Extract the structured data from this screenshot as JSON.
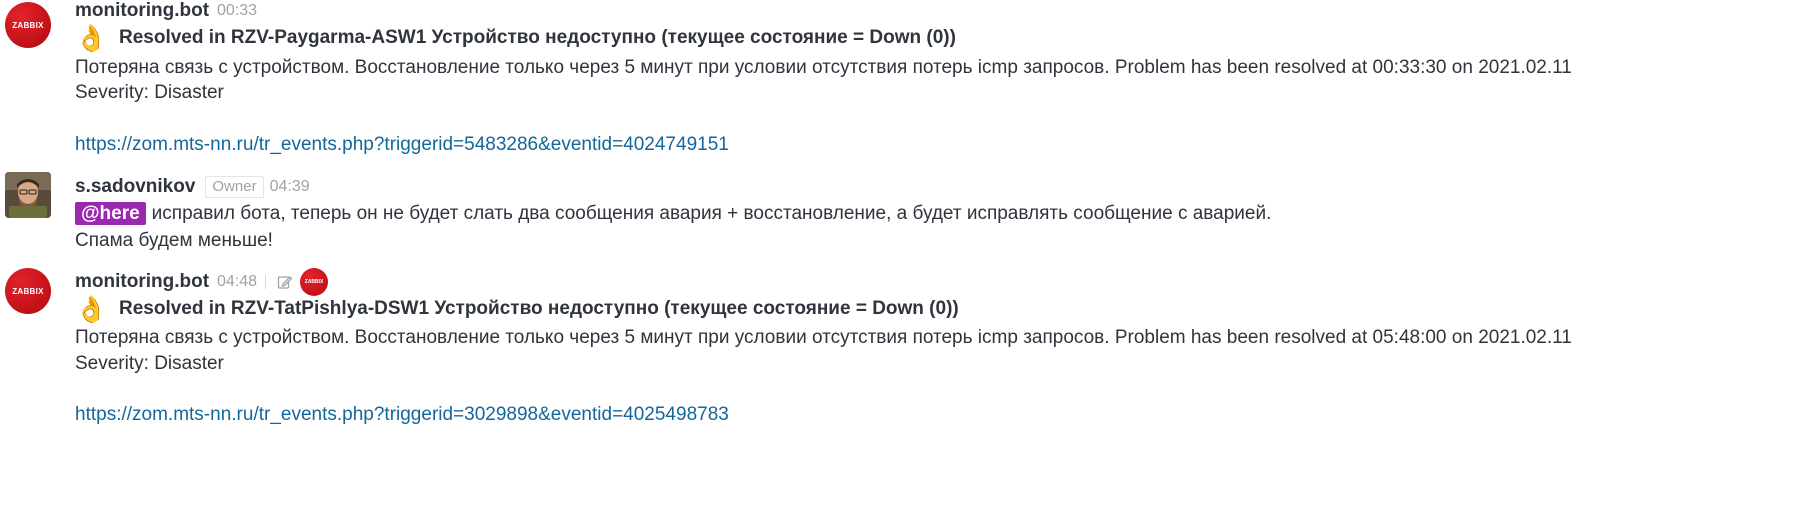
{
  "messages": [
    {
      "username": "monitoring.bot",
      "time": "00:33",
      "avatar_text": "ZABBIX",
      "title_emoji": "👌",
      "title": "Resolved in RZV-Paygarma-ASW1 Устройство недоступно (текущее состояние = Down (0))",
      "body": "Потеряна связь с устройством. Восстановление только через 5 минут при условии отсутствия потерь icmp запросов. Problem has been resolved at 00:33:30 on 2021.02.11",
      "severity": "Severity: Disaster",
      "link": "https://zom.mts-nn.ru/tr_events.php?triggerid=5483286&eventid=4024749151"
    },
    {
      "username": "s.sadovnikov",
      "role": "Owner",
      "time": "04:39",
      "mention": "@here",
      "text": "исправил бота, теперь он не будет слать два сообщения авария + восстановление, а будет исправлять сообщение с аварией.",
      "text2": "Спама будем меньше!"
    },
    {
      "username": "monitoring.bot",
      "time": "04:48",
      "avatar_text": "ZABBIX",
      "title_emoji": "👌",
      "title": "Resolved in RZV-TatPishlya-DSW1 Устройство недоступно (текущее состояние = Down (0))",
      "body": "Потеряна связь с устройством. Восстановление только через 5 минут при условии отсутствия потерь icmp запросов. Problem has been resolved at 05:48:00 on 2021.02.11",
      "severity": "Severity: Disaster",
      "link": "https://zom.mts-nn.ru/tr_events.php?triggerid=3029898&eventid=4025498783"
    }
  ],
  "icons": {
    "edited": "pencil-edit-icon",
    "reaction": "zabbix-reaction-badge"
  },
  "colors": {
    "link": "#13679a",
    "mention_bg": "#9c27b0",
    "zabbix_red": "#c7121a"
  }
}
